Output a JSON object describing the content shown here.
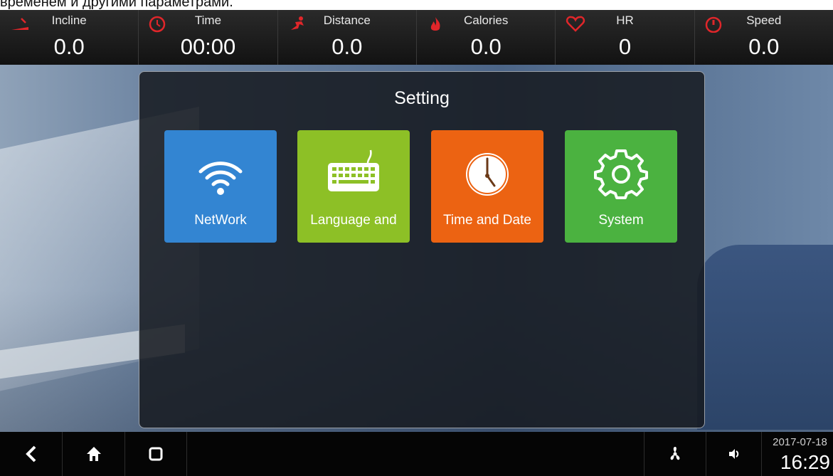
{
  "caption": "временем и другими параметрами.",
  "stats": [
    {
      "label": "Incline",
      "value": "0.0",
      "icon": "incline-icon",
      "color": "#e0262a"
    },
    {
      "label": "Time",
      "value": "00:00",
      "icon": "clock-icon",
      "color": "#e0262a"
    },
    {
      "label": "Distance",
      "value": "0.0",
      "icon": "runner-icon",
      "color": "#e0262a"
    },
    {
      "label": "Calories",
      "value": "0.0",
      "icon": "flame-icon",
      "color": "#e0262a"
    },
    {
      "label": "HR",
      "value": "0",
      "icon": "heart-icon",
      "color": "#e0262a"
    },
    {
      "label": "Speed",
      "value": "0.0",
      "icon": "speedometer-icon",
      "color": "#e0262a"
    }
  ],
  "dialog": {
    "title": "Setting",
    "tiles": [
      {
        "label": "NetWork",
        "icon": "wifi-icon",
        "color": "#3385d2"
      },
      {
        "label": "Language and",
        "icon": "keyboard-icon",
        "color": "#8dc026"
      },
      {
        "label": "Time and Date",
        "icon": "clock-icon",
        "color": "#ec6312"
      },
      {
        "label": "System",
        "icon": "gear-icon",
        "color": "#4bb240"
      }
    ]
  },
  "navbar": {
    "back_icon": "back-icon",
    "home_icon": "home-icon",
    "recent_icon": "recent-apps-icon",
    "fan_icon": "fan-icon",
    "volume_icon": "volume-icon",
    "date": "2017-07-18",
    "time": "16:29"
  }
}
